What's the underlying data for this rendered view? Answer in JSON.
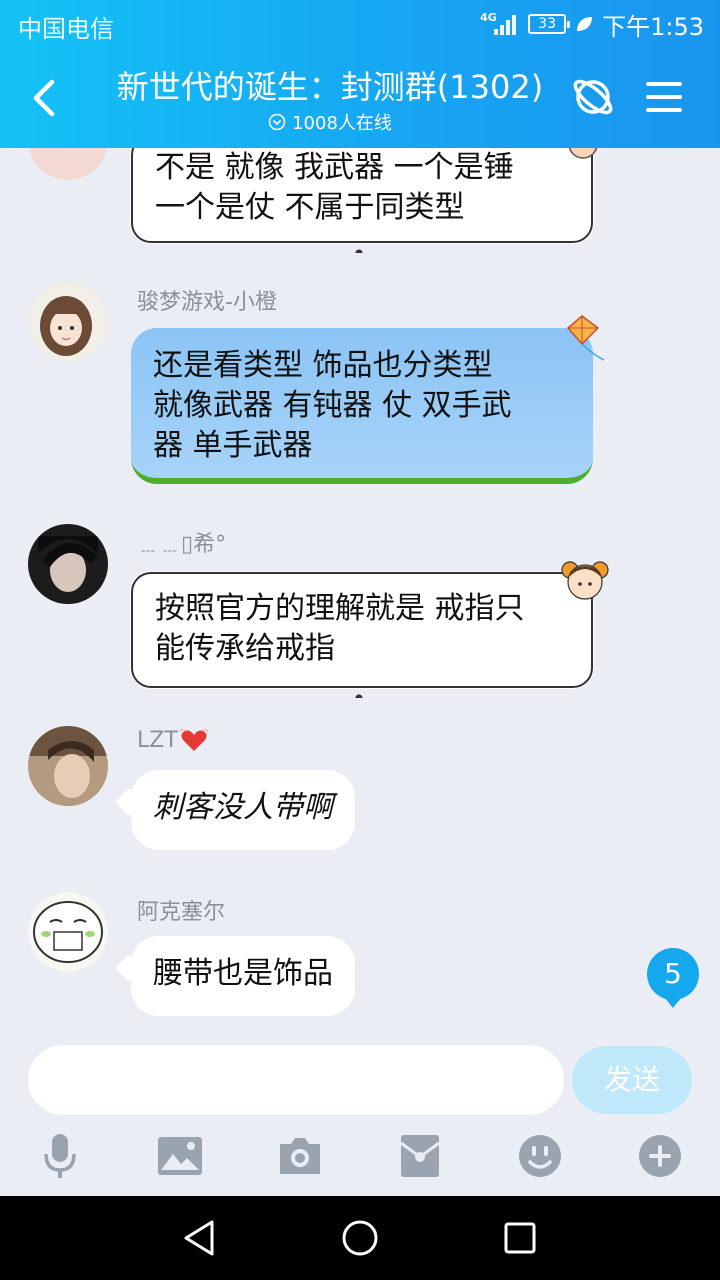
{
  "status_bar": {
    "carrier": "中国电信",
    "network": "4G",
    "battery": "33",
    "time": "下午1:53"
  },
  "header": {
    "title": "新世代的诞生：封测群(1302)",
    "online_count": "1008人在线",
    "back_icon": "chevron-left-icon",
    "planet_icon": "planet-icon",
    "menu_icon": "hamburger-menu-icon"
  },
  "messages": [
    {
      "sender": "",
      "text": "不是 就像 我武器 一个是锤\n一个是仗 不属于同类型",
      "style": "cloud"
    },
    {
      "sender": "骏梦游戏-小橙",
      "text": "还是看类型  饰品也分类型\n就像武器 有钝器 仗  双手武\n器 单手武器",
      "style": "sky"
    },
    {
      "sender": "﹍﹍▯希°",
      "text": "按照官方的理解就是 戒指只\n能传承给戒指",
      "style": "cloud"
    },
    {
      "sender": "LZT",
      "text": "刺客没人带啊",
      "style": "white"
    },
    {
      "sender": "阿克塞尔",
      "text": "腰带也是饰品",
      "style": "white"
    }
  ],
  "unread_count": "5",
  "input": {
    "value": "",
    "placeholder": ""
  },
  "send_label": "发送",
  "toolbar": [
    "microphone-icon",
    "image-icon",
    "camera-icon",
    "red-packet-icon",
    "emoji-icon",
    "plus-icon"
  ],
  "colors": {
    "header": "#17a4f1",
    "background": "#eaedf4",
    "send_disabled": "#bfe9fb",
    "unread_badge": "#16a8ef"
  }
}
